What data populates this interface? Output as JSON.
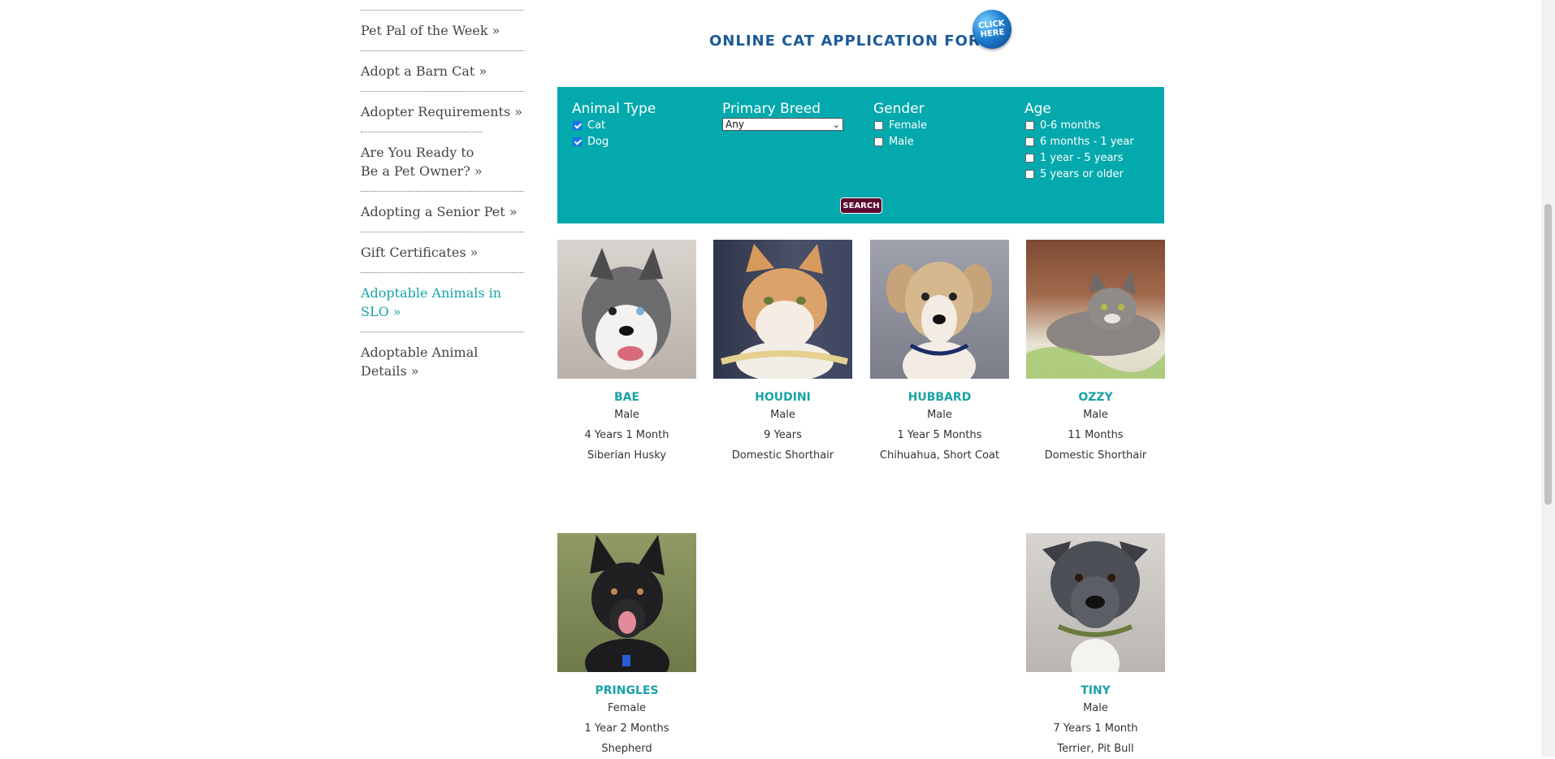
{
  "sidebar": {
    "items": [
      {
        "label": "Pet Pal of the Week »",
        "active": false
      },
      {
        "label": "Adopt a Barn Cat »",
        "active": false
      },
      {
        "label": "Adopter Requirements »",
        "active": false
      },
      {
        "label": "Are You Ready to Be a Pet Owner? »",
        "active": false
      },
      {
        "label": "Adopting a Senior Pet »",
        "active": false
      },
      {
        "label": "Gift Certificates »",
        "active": false
      },
      {
        "label": "Adoptable Animals in SLO »",
        "active": true
      },
      {
        "label": "Adoptable Animal Details »",
        "active": false
      }
    ]
  },
  "application": {
    "heading": "ONLINE CAT APPLICATION FORM",
    "click_line1": "CLICK",
    "click_line2": "HERE"
  },
  "search": {
    "animal_type": {
      "title": "Animal Type",
      "options": [
        {
          "label": "Cat",
          "checked": true
        },
        {
          "label": "Dog",
          "checked": true
        }
      ]
    },
    "primary_breed": {
      "title": "Primary Breed",
      "selected": "Any"
    },
    "gender": {
      "title": "Gender",
      "options": [
        {
          "label": "Female",
          "checked": false
        },
        {
          "label": "Male",
          "checked": false
        }
      ]
    },
    "age": {
      "title": "Age",
      "options": [
        {
          "label": "0-6 months",
          "checked": false
        },
        {
          "label": "6 months - 1 year",
          "checked": false
        },
        {
          "label": "1 year - 5 years",
          "checked": false
        },
        {
          "label": "5 years or older",
          "checked": false
        }
      ]
    },
    "button": "SEARCH"
  },
  "animals": [
    {
      "name": "BAE",
      "gender": "Male",
      "age": "4 Years 1 Month",
      "breed": "Siberian Husky",
      "photo_icon": "husky-photo",
      "bg": "#d9d4cf"
    },
    {
      "name": "HOUDINI",
      "gender": "Male",
      "age": "9 Years",
      "breed": "Domestic Shorthair",
      "photo_icon": "orange-white-cat-photo",
      "bg": "#3c4560"
    },
    {
      "name": "HUBBARD",
      "gender": "Male",
      "age": "1 Year 5 Months",
      "breed": "Chihuahua, Short Coat",
      "photo_icon": "tan-dog-photo",
      "bg": "#8c8e99"
    },
    {
      "name": "OZZY",
      "gender": "Male",
      "age": "11 Months",
      "breed": "Domestic Shorthair",
      "photo_icon": "tabby-cat-photo",
      "bg": "#a26a4c"
    },
    {
      "name": "PRINGLES",
      "gender": "Female",
      "age": "1 Year 2 Months",
      "breed": "Shepherd",
      "photo_icon": "black-shepherd-photo",
      "bg": "#7e8b5a"
    },
    {
      "name": "TINY",
      "gender": "Male",
      "age": "7 Years 1 Month",
      "breed": "Terrier, Pit Bull",
      "photo_icon": "pitbull-photo",
      "bg": "#c9c6c2"
    }
  ],
  "colors": {
    "panel": "#03a9ad",
    "accent": "#1aa3a6",
    "heading": "#1c5a99",
    "button": "#5a0b2f"
  }
}
